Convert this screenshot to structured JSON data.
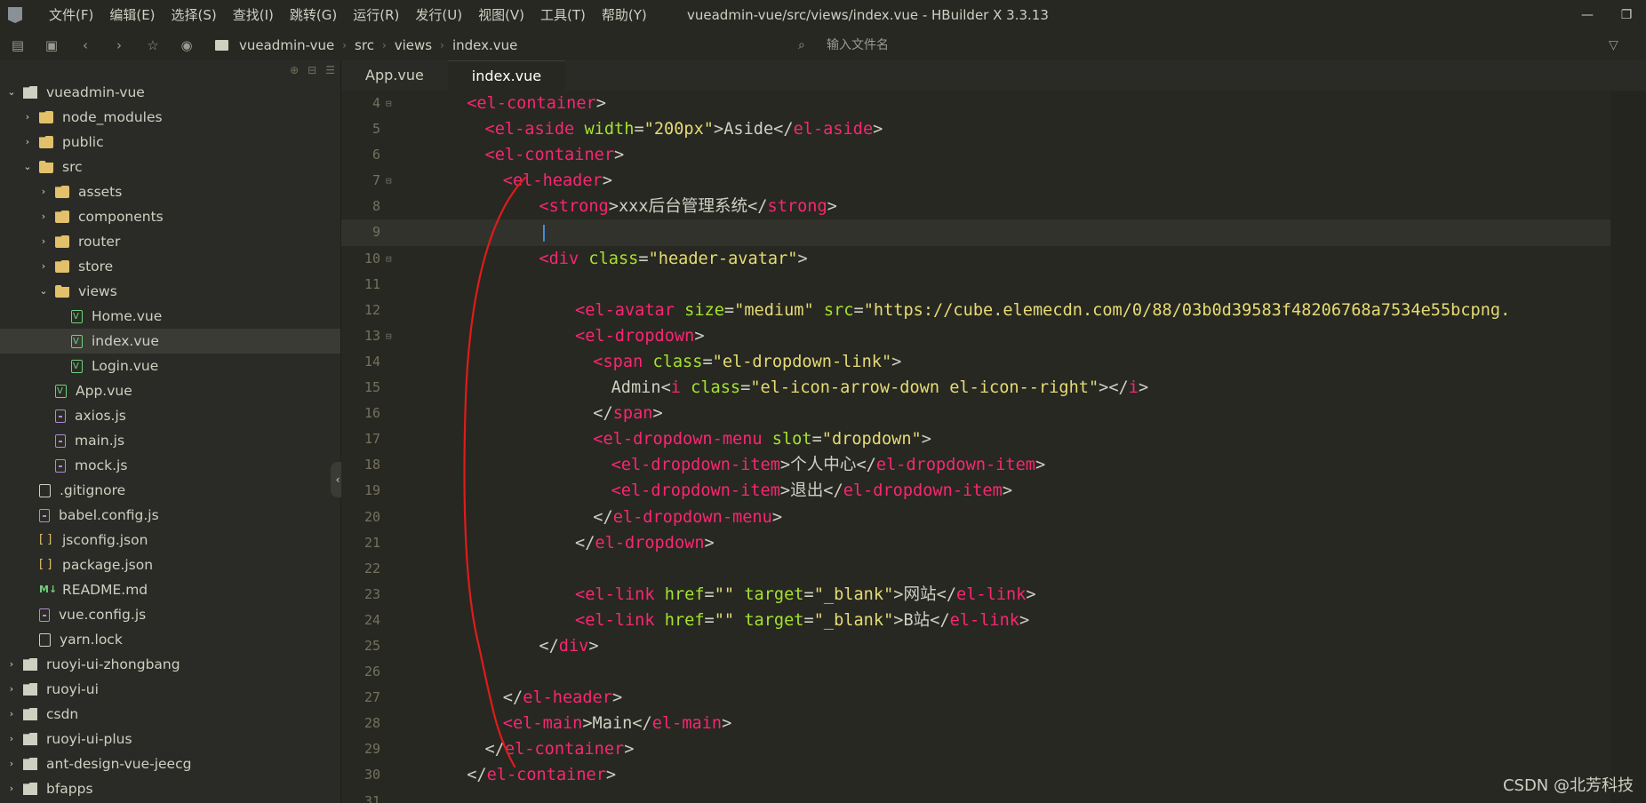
{
  "menu": [
    "文件(F)",
    "编辑(E)",
    "选择(S)",
    "查找(I)",
    "跳转(G)",
    "运行(R)",
    "发行(U)",
    "视图(V)",
    "工具(T)",
    "帮助(Y)"
  ],
  "window_title": "vueadmin-vue/src/views/index.vue - HBuilder X 3.3.13",
  "breadcrumb": [
    "vueadmin-vue",
    "src",
    "views",
    "index.vue"
  ],
  "file_search": {
    "placeholder": "输入文件名"
  },
  "tree": [
    {
      "label": "vueadmin-vue",
      "depth": 0,
      "icon": "project-icon",
      "chev": "v"
    },
    {
      "label": "node_modules",
      "depth": 1,
      "icon": "folder-icon",
      "chev": ">"
    },
    {
      "label": "public",
      "depth": 1,
      "icon": "folder-icon",
      "chev": ">"
    },
    {
      "label": "src",
      "depth": 1,
      "icon": "folder-open-icon",
      "chev": "v"
    },
    {
      "label": "assets",
      "depth": 2,
      "icon": "folder-icon",
      "chev": ">"
    },
    {
      "label": "components",
      "depth": 2,
      "icon": "folder-icon",
      "chev": ">"
    },
    {
      "label": "router",
      "depth": 2,
      "icon": "folder-icon",
      "chev": ">"
    },
    {
      "label": "store",
      "depth": 2,
      "icon": "folder-icon",
      "chev": ">"
    },
    {
      "label": "views",
      "depth": 2,
      "icon": "folder-open-icon",
      "chev": "v"
    },
    {
      "label": "Home.vue",
      "depth": 3,
      "icon": "vue-file-icon",
      "chev": ""
    },
    {
      "label": "index.vue",
      "depth": 3,
      "icon": "vue-file-icon",
      "chev": "",
      "selected": true
    },
    {
      "label": "Login.vue",
      "depth": 3,
      "icon": "vue-file-icon",
      "chev": ""
    },
    {
      "label": "App.vue",
      "depth": 2,
      "icon": "vue-file-icon",
      "chev": ""
    },
    {
      "label": "axios.js",
      "depth": 2,
      "icon": "js-file-icon",
      "chev": ""
    },
    {
      "label": "main.js",
      "depth": 2,
      "icon": "js-file-icon",
      "chev": ""
    },
    {
      "label": "mock.js",
      "depth": 2,
      "icon": "js-file-icon",
      "chev": ""
    },
    {
      "label": ".gitignore",
      "depth": 1,
      "icon": "text-file-icon",
      "chev": ""
    },
    {
      "label": "babel.config.js",
      "depth": 1,
      "icon": "js-file-icon",
      "chev": ""
    },
    {
      "label": "jsconfig.json",
      "depth": 1,
      "icon": "json-file-icon",
      "chev": ""
    },
    {
      "label": "package.json",
      "depth": 1,
      "icon": "json-file-icon",
      "chev": ""
    },
    {
      "label": "README.md",
      "depth": 1,
      "icon": "markdown-file-icon",
      "chev": ""
    },
    {
      "label": "vue.config.js",
      "depth": 1,
      "icon": "js-file-icon",
      "chev": ""
    },
    {
      "label": "yarn.lock",
      "depth": 1,
      "icon": "text-file-icon",
      "chev": ""
    },
    {
      "label": "ruoyi-ui-zhongbang",
      "depth": 0,
      "icon": "project-icon",
      "chev": ">"
    },
    {
      "label": "ruoyi-ui",
      "depth": 0,
      "icon": "project-icon",
      "chev": ">"
    },
    {
      "label": "csdn",
      "depth": 0,
      "icon": "project-icon",
      "chev": ">"
    },
    {
      "label": "ruoyi-ui-plus",
      "depth": 0,
      "icon": "project-icon",
      "chev": ">"
    },
    {
      "label": "ant-design-vue-jeecg",
      "depth": 0,
      "icon": "project-icon",
      "chev": ">"
    },
    {
      "label": "bfapps",
      "depth": 0,
      "icon": "project-icon",
      "chev": ">"
    }
  ],
  "tabs": [
    {
      "label": "App.vue",
      "active": false
    },
    {
      "label": "index.vue",
      "active": true
    }
  ],
  "code_lines": [
    {
      "n": "4",
      "fold": true,
      "indent": 4,
      "tokens": [
        [
          "tag",
          "<el-container"
        ],
        [
          "pl",
          ">"
        ]
      ]
    },
    {
      "n": "5",
      "indent": 5,
      "tokens": [
        [
          "tag",
          "<el-aside "
        ],
        [
          "attr",
          "width"
        ],
        [
          "pl",
          "="
        ],
        [
          "str",
          "\"200px\""
        ],
        [
          "pl",
          ">Aside</"
        ],
        [
          "tag",
          "el-aside"
        ],
        [
          "pl",
          ">"
        ]
      ]
    },
    {
      "n": "6",
      "indent": 5,
      "tokens": [
        [
          "tag",
          "<el-container"
        ],
        [
          "pl",
          ">"
        ]
      ]
    },
    {
      "n": "7",
      "fold": true,
      "indent": 6,
      "tokens": [
        [
          "tag",
          "<el-header"
        ],
        [
          "pl",
          ">"
        ]
      ]
    },
    {
      "n": "8",
      "indent": 8,
      "tokens": [
        [
          "tag",
          "<strong"
        ],
        [
          "pl",
          ">xxx后台管理系统</"
        ],
        [
          "tag",
          "strong"
        ],
        [
          "pl",
          ">"
        ]
      ]
    },
    {
      "n": "9",
      "indent": 8,
      "current": true,
      "tokens": [
        [
          "pl",
          "|"
        ]
      ]
    },
    {
      "n": "10",
      "fold": true,
      "indent": 8,
      "tokens": [
        [
          "tag",
          "<div "
        ],
        [
          "attr",
          "class"
        ],
        [
          "pl",
          "="
        ],
        [
          "str",
          "\"header-avatar\""
        ],
        [
          "pl",
          ">"
        ]
      ]
    },
    {
      "n": "11",
      "indent": 0,
      "tokens": []
    },
    {
      "n": "12",
      "indent": 10,
      "tokens": [
        [
          "tag",
          "<el-avatar "
        ],
        [
          "attr",
          "size"
        ],
        [
          "pl",
          "="
        ],
        [
          "str",
          "\"medium\""
        ],
        [
          "pl",
          " "
        ],
        [
          "attr",
          "src"
        ],
        [
          "pl",
          "="
        ],
        [
          "str",
          "\"https://cube.elemecdn.com/0/88/03b0d39583f48206768a7534e55bcpng."
        ]
      ]
    },
    {
      "n": "13",
      "fold": true,
      "indent": 10,
      "tokens": [
        [
          "tag",
          "<el-dropdown"
        ],
        [
          "pl",
          ">"
        ]
      ]
    },
    {
      "n": "14",
      "indent": 11,
      "tokens": [
        [
          "tag",
          "<span "
        ],
        [
          "attr",
          "class"
        ],
        [
          "pl",
          "="
        ],
        [
          "str",
          "\"el-dropdown-link\""
        ],
        [
          "pl",
          ">"
        ]
      ]
    },
    {
      "n": "15",
      "indent": 12,
      "tokens": [
        [
          "pl",
          "Admin<"
        ],
        [
          "tag",
          "i "
        ],
        [
          "attr",
          "class"
        ],
        [
          "pl",
          "="
        ],
        [
          "str",
          "\"el-icon-arrow-down el-icon--right\""
        ],
        [
          "pl",
          "></"
        ],
        [
          "tag",
          "i"
        ],
        [
          "pl",
          ">"
        ]
      ]
    },
    {
      "n": "16",
      "indent": 11,
      "tokens": [
        [
          "pl",
          "</"
        ],
        [
          "tag",
          "span"
        ],
        [
          "pl",
          ">"
        ]
      ]
    },
    {
      "n": "17",
      "indent": 11,
      "tokens": [
        [
          "tag",
          "<el-dropdown-menu "
        ],
        [
          "attr",
          "slot"
        ],
        [
          "pl",
          "="
        ],
        [
          "str",
          "\"dropdown\""
        ],
        [
          "pl",
          ">"
        ]
      ]
    },
    {
      "n": "18",
      "indent": 12,
      "tokens": [
        [
          "tag",
          "<el-dropdown-item"
        ],
        [
          "pl",
          ">个人中心</"
        ],
        [
          "tag",
          "el-dropdown-item"
        ],
        [
          "pl",
          ">"
        ]
      ]
    },
    {
      "n": "19",
      "indent": 12,
      "tokens": [
        [
          "tag",
          "<el-dropdown-item"
        ],
        [
          "pl",
          ">退出</"
        ],
        [
          "tag",
          "el-dropdown-item"
        ],
        [
          "pl",
          ">"
        ]
      ]
    },
    {
      "n": "20",
      "indent": 11,
      "tokens": [
        [
          "pl",
          "</"
        ],
        [
          "tag",
          "el-dropdown-menu"
        ],
        [
          "pl",
          ">"
        ]
      ]
    },
    {
      "n": "21",
      "indent": 10,
      "tokens": [
        [
          "pl",
          "</"
        ],
        [
          "tag",
          "el-dropdown"
        ],
        [
          "pl",
          ">"
        ]
      ]
    },
    {
      "n": "22",
      "indent": 0,
      "tokens": []
    },
    {
      "n": "23",
      "indent": 10,
      "tokens": [
        [
          "tag",
          "<el-link "
        ],
        [
          "attr",
          "href"
        ],
        [
          "pl",
          "="
        ],
        [
          "str",
          "\"\""
        ],
        [
          "pl",
          " "
        ],
        [
          "attr",
          "target"
        ],
        [
          "pl",
          "="
        ],
        [
          "str",
          "\"_blank\""
        ],
        [
          "pl",
          ">网站</"
        ],
        [
          "tag",
          "el-link"
        ],
        [
          "pl",
          ">"
        ]
      ]
    },
    {
      "n": "24",
      "indent": 10,
      "tokens": [
        [
          "tag",
          "<el-link "
        ],
        [
          "attr",
          "href"
        ],
        [
          "pl",
          "="
        ],
        [
          "str",
          "\"\""
        ],
        [
          "pl",
          " "
        ],
        [
          "attr",
          "target"
        ],
        [
          "pl",
          "="
        ],
        [
          "str",
          "\"_blank\""
        ],
        [
          "pl",
          ">B站</"
        ],
        [
          "tag",
          "el-link"
        ],
        [
          "pl",
          ">"
        ]
      ]
    },
    {
      "n": "25",
      "indent": 8,
      "tokens": [
        [
          "pl",
          "</"
        ],
        [
          "tag",
          "div"
        ],
        [
          "pl",
          ">"
        ]
      ]
    },
    {
      "n": "26",
      "indent": 0,
      "tokens": []
    },
    {
      "n": "27",
      "indent": 6,
      "tokens": [
        [
          "pl",
          "</"
        ],
        [
          "tag",
          "el-header"
        ],
        [
          "pl",
          ">"
        ]
      ]
    },
    {
      "n": "28",
      "indent": 6,
      "tokens": [
        [
          "tag",
          "<el-main"
        ],
        [
          "pl",
          ">Main</"
        ],
        [
          "tag",
          "el-main"
        ],
        [
          "pl",
          ">"
        ]
      ]
    },
    {
      "n": "29",
      "indent": 5,
      "tokens": [
        [
          "pl",
          "</"
        ],
        [
          "tag",
          "el-container"
        ],
        [
          "pl",
          ">"
        ]
      ]
    },
    {
      "n": "30",
      "indent": 4,
      "tokens": [
        [
          "pl",
          "</"
        ],
        [
          "tag",
          "el-container"
        ],
        [
          "pl",
          ">"
        ]
      ]
    },
    {
      "n": "31",
      "indent": 0,
      "tokens": []
    }
  ],
  "watermark": "CSDN @北芳科技",
  "colors": {
    "tag": "#f92672",
    "attr": "#a6e22e",
    "string": "#e6db74",
    "annotation": "#e01b1b"
  }
}
